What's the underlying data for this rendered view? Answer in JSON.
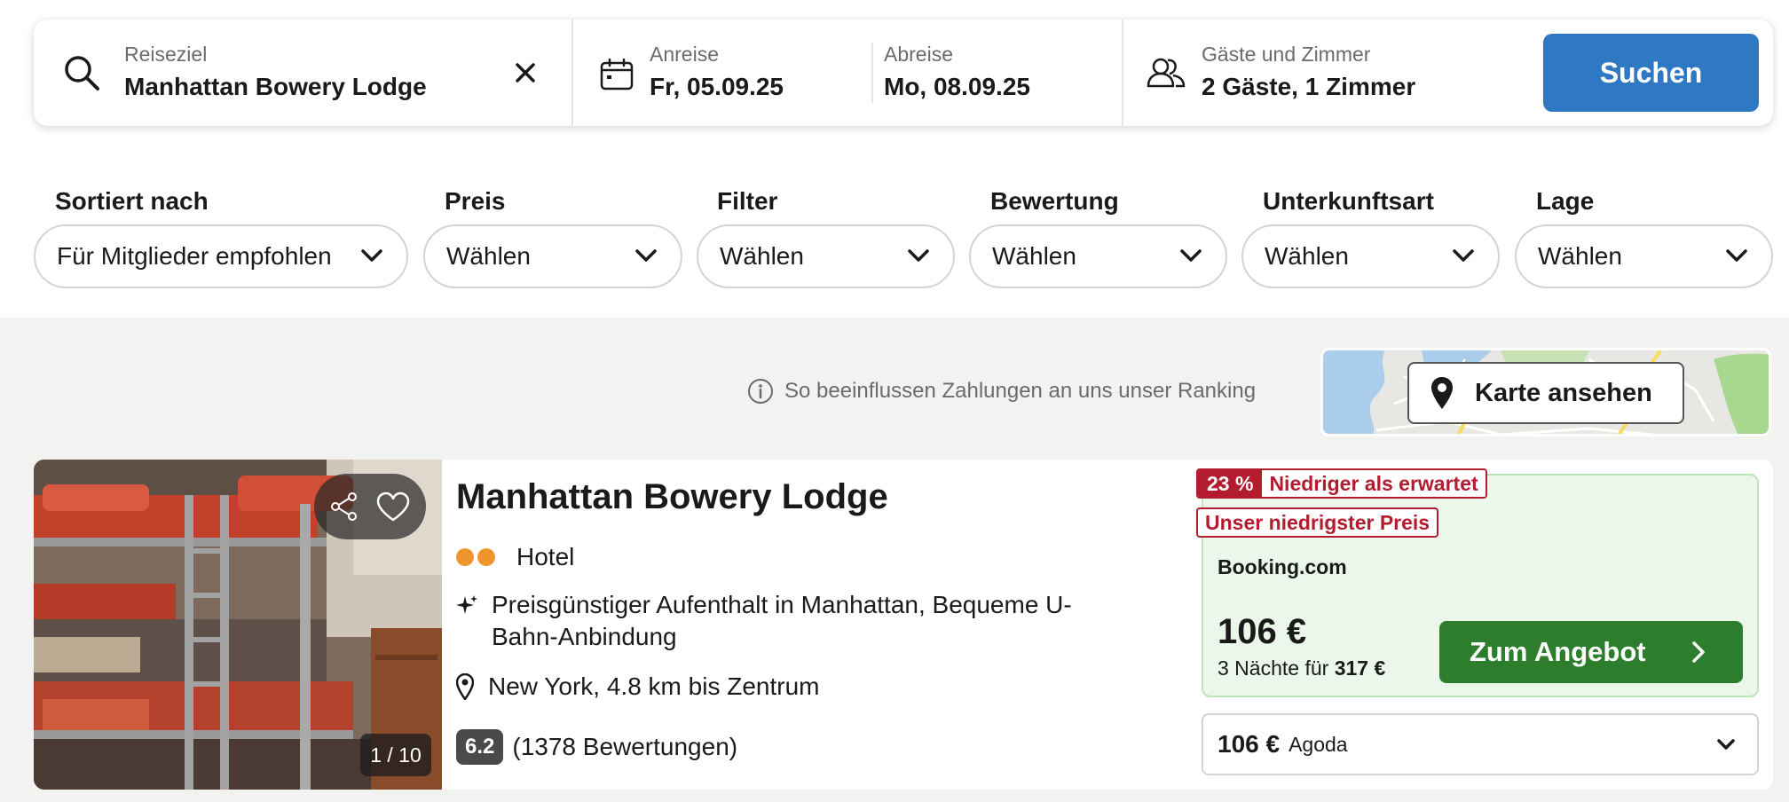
{
  "search": {
    "destination_label": "Reiseziel",
    "destination_value": "Manhattan Bowery Lodge",
    "checkin_label": "Anreise",
    "checkin_value": "Fr, 05.09.25",
    "checkout_label": "Abreise",
    "checkout_value": "Mo, 08.09.25",
    "guests_label": "Gäste und Zimmer",
    "guests_value": "2 Gäste, 1 Zimmer",
    "search_button": "Suchen"
  },
  "filters": [
    {
      "label": "Sortiert nach",
      "value": "Für Mitglieder empfohlen"
    },
    {
      "label": "Preis",
      "value": "Wählen"
    },
    {
      "label": "Filter",
      "value": "Wählen"
    },
    {
      "label": "Bewertung",
      "value": "Wählen"
    },
    {
      "label": "Unterkunftsart",
      "value": "Wählen"
    },
    {
      "label": "Lage",
      "value": "Wählen"
    }
  ],
  "ranking_note": "So beeinflussen Zahlungen an uns unser Ranking",
  "map_button": "Karte ansehen",
  "hotel": {
    "name": "Manhattan Bowery Lodge",
    "type": "Hotel",
    "highlight": "Preisgünstiger Aufenthalt in Manhattan, Bequeme U-Bahn-Anbindung",
    "location": "New York, 4.8 km bis Zentrum",
    "rating": "6.2",
    "reviews": "(1378 Bewertungen)",
    "photo_counter": "1 / 10",
    "deal_percent": "23 %",
    "deal_text": "Niedriger als erwartet",
    "lowest_price_badge": "Unser niedrigster Preis",
    "provider": "Booking.com",
    "price": "106 €",
    "nights_text": "3 Nächte für",
    "total_price": "317 €",
    "deal_button": "Zum Angebot",
    "alt_price": "106 €",
    "alt_provider": "Agoda"
  },
  "colors": {
    "search_button": "#2f78c4",
    "deal_button": "#2c7e2c",
    "badge_red": "#b31b2e",
    "offer_bg": "#ebf7ea",
    "star_dots": "#f0952b"
  }
}
